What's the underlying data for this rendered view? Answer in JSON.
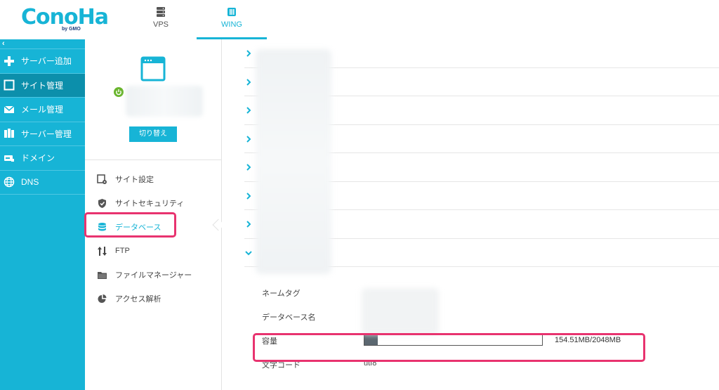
{
  "header": {
    "logo": "ConoHa",
    "logo_sub": "by GMO",
    "tabs": [
      {
        "label": "VPS",
        "icon": "server-icon"
      },
      {
        "label": "WING",
        "icon": "wing-server-icon",
        "active": true
      }
    ]
  },
  "sidebar": {
    "collapse_icon": "chevron-left-icon",
    "items": [
      {
        "label": "サーバー追加",
        "icon": "plus-icon"
      },
      {
        "label": "サイト管理",
        "icon": "window-icon",
        "active": true
      },
      {
        "label": "メール管理",
        "icon": "mail-icon"
      },
      {
        "label": "サーバー管理",
        "icon": "server-manage-icon"
      },
      {
        "label": "ドメイン",
        "icon": "domain-icon"
      },
      {
        "label": "DNS",
        "icon": "globe-icon"
      }
    ]
  },
  "site_panel": {
    "switch_label": "切り替え",
    "menu": [
      {
        "label": "サイト設定",
        "icon": "site-settings-icon"
      },
      {
        "label": "サイトセキュリティ",
        "icon": "shield-icon"
      },
      {
        "label": "データベース",
        "icon": "database-icon",
        "selected": true
      },
      {
        "label": "FTP",
        "icon": "ftp-arrows-icon"
      },
      {
        "label": "ファイルマネージャー",
        "icon": "folder-icon"
      },
      {
        "label": "アクセス解析",
        "icon": "pie-chart-icon"
      }
    ]
  },
  "database_detail": {
    "labels": {
      "name_tag": "ネームタグ",
      "db_name": "データベース名",
      "capacity": "容量",
      "charset": "文字コード"
    },
    "capacity_text": "154.51MB/2048MB",
    "capacity_used_fraction": 0.0755,
    "charset_value": "utf8"
  },
  "colors": {
    "accent": "#17b4d6",
    "sidebar_active": "#0c8fab",
    "highlight": "#e8336f"
  }
}
